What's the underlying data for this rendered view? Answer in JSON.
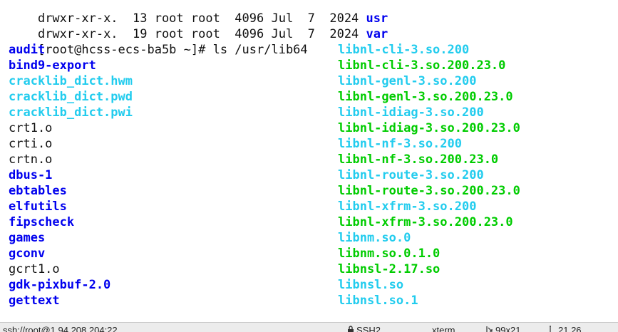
{
  "colors": {
    "text": "#111111",
    "directory": "#0000ee",
    "symlink": "#22ccee",
    "executable": "#00cc00",
    "statusbar_bg": "#ececec"
  },
  "terminal": {
    "header_lines": [
      {
        "prefix": "drwxr-xr-x.  13 root root  4096 Jul  7  2024 ",
        "name": "usr",
        "type": "directory"
      },
      {
        "prefix": "drwxr-xr-x.  19 root root  4096 Jul  7  2024 ",
        "name": "var",
        "type": "directory"
      }
    ],
    "prompt": "[root@hcss-ecs-ba5b ~]# ",
    "command": "ls /usr/lib64",
    "rows": [
      [
        {
          "text": "audit",
          "type": "directory"
        },
        {
          "text": "libnl-cli-3.so.200",
          "type": "symlink"
        }
      ],
      [
        {
          "text": "bind9-export",
          "type": "directory"
        },
        {
          "text": "libnl-cli-3.so.200.23.0",
          "type": "executable"
        }
      ],
      [
        {
          "text": "cracklib_dict.hwm",
          "type": "symlink"
        },
        {
          "text": "libnl-genl-3.so.200",
          "type": "symlink"
        }
      ],
      [
        {
          "text": "cracklib_dict.pwd",
          "type": "symlink"
        },
        {
          "text": "libnl-genl-3.so.200.23.0",
          "type": "executable"
        }
      ],
      [
        {
          "text": "cracklib_dict.pwi",
          "type": "symlink"
        },
        {
          "text": "libnl-idiag-3.so.200",
          "type": "symlink"
        }
      ],
      [
        {
          "text": "crt1.o",
          "type": "file"
        },
        {
          "text": "libnl-idiag-3.so.200.23.0",
          "type": "executable"
        }
      ],
      [
        {
          "text": "crti.o",
          "type": "file"
        },
        {
          "text": "libnl-nf-3.so.200",
          "type": "symlink"
        }
      ],
      [
        {
          "text": "crtn.o",
          "type": "file"
        },
        {
          "text": "libnl-nf-3.so.200.23.0",
          "type": "executable"
        }
      ],
      [
        {
          "text": "dbus-1",
          "type": "directory"
        },
        {
          "text": "libnl-route-3.so.200",
          "type": "symlink"
        }
      ],
      [
        {
          "text": "ebtables",
          "type": "directory"
        },
        {
          "text": "libnl-route-3.so.200.23.0",
          "type": "executable"
        }
      ],
      [
        {
          "text": "elfutils",
          "type": "directory"
        },
        {
          "text": "libnl-xfrm-3.so.200",
          "type": "symlink"
        }
      ],
      [
        {
          "text": "fipscheck",
          "type": "directory"
        },
        {
          "text": "libnl-xfrm-3.so.200.23.0",
          "type": "executable"
        }
      ],
      [
        {
          "text": "games",
          "type": "directory"
        },
        {
          "text": "libnm.so.0",
          "type": "symlink"
        }
      ],
      [
        {
          "text": "gconv",
          "type": "directory"
        },
        {
          "text": "libnm.so.0.1.0",
          "type": "executable"
        }
      ],
      [
        {
          "text": "gcrt1.o",
          "type": "file"
        },
        {
          "text": "libnsl-2.17.so",
          "type": "executable"
        }
      ],
      [
        {
          "text": "gdk-pixbuf-2.0",
          "type": "directory"
        },
        {
          "text": "libnsl.so",
          "type": "symlink"
        }
      ],
      [
        {
          "text": "gettext",
          "type": "directory"
        },
        {
          "text": "libnsl.so.1",
          "type": "symlink"
        }
      ]
    ]
  },
  "statusbar": {
    "connection": "ssh://root@1.94.208.204:22",
    "protocol": "SSH2",
    "protocol_icon": "lock-icon",
    "terminal_type": "xterm",
    "size": "99x21",
    "size_icon": "resize-icon",
    "position": "21,26",
    "position_icon": "cursor-position-icon"
  }
}
